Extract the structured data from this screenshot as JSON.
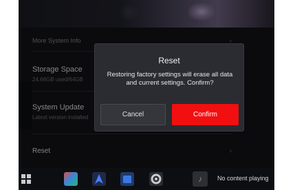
{
  "settings": {
    "more_info": "More System Info",
    "storage_title": "Storage Space",
    "storage_sub": "24.66GB used/64GB",
    "update_title": "System Update",
    "update_sub": "Latest version installed",
    "reset_title": "Reset"
  },
  "dialog": {
    "title": "Reset",
    "message": "Restoring factory settings will erase all data and current settings. Confirm?",
    "cancel_label": "Cancel",
    "confirm_label": "Confirm"
  },
  "dock": {
    "status": "No content playing"
  },
  "colors": {
    "accent": "#f20f10",
    "dialog_bg": "#2b2c31",
    "screen_bg": "#121316"
  },
  "icons": {
    "home": "grid-icon",
    "app1": "app-icon",
    "app2": "navigation-icon",
    "app3": "calendar-icon",
    "app4": "settings-gear-icon",
    "music": "music-note-icon"
  }
}
